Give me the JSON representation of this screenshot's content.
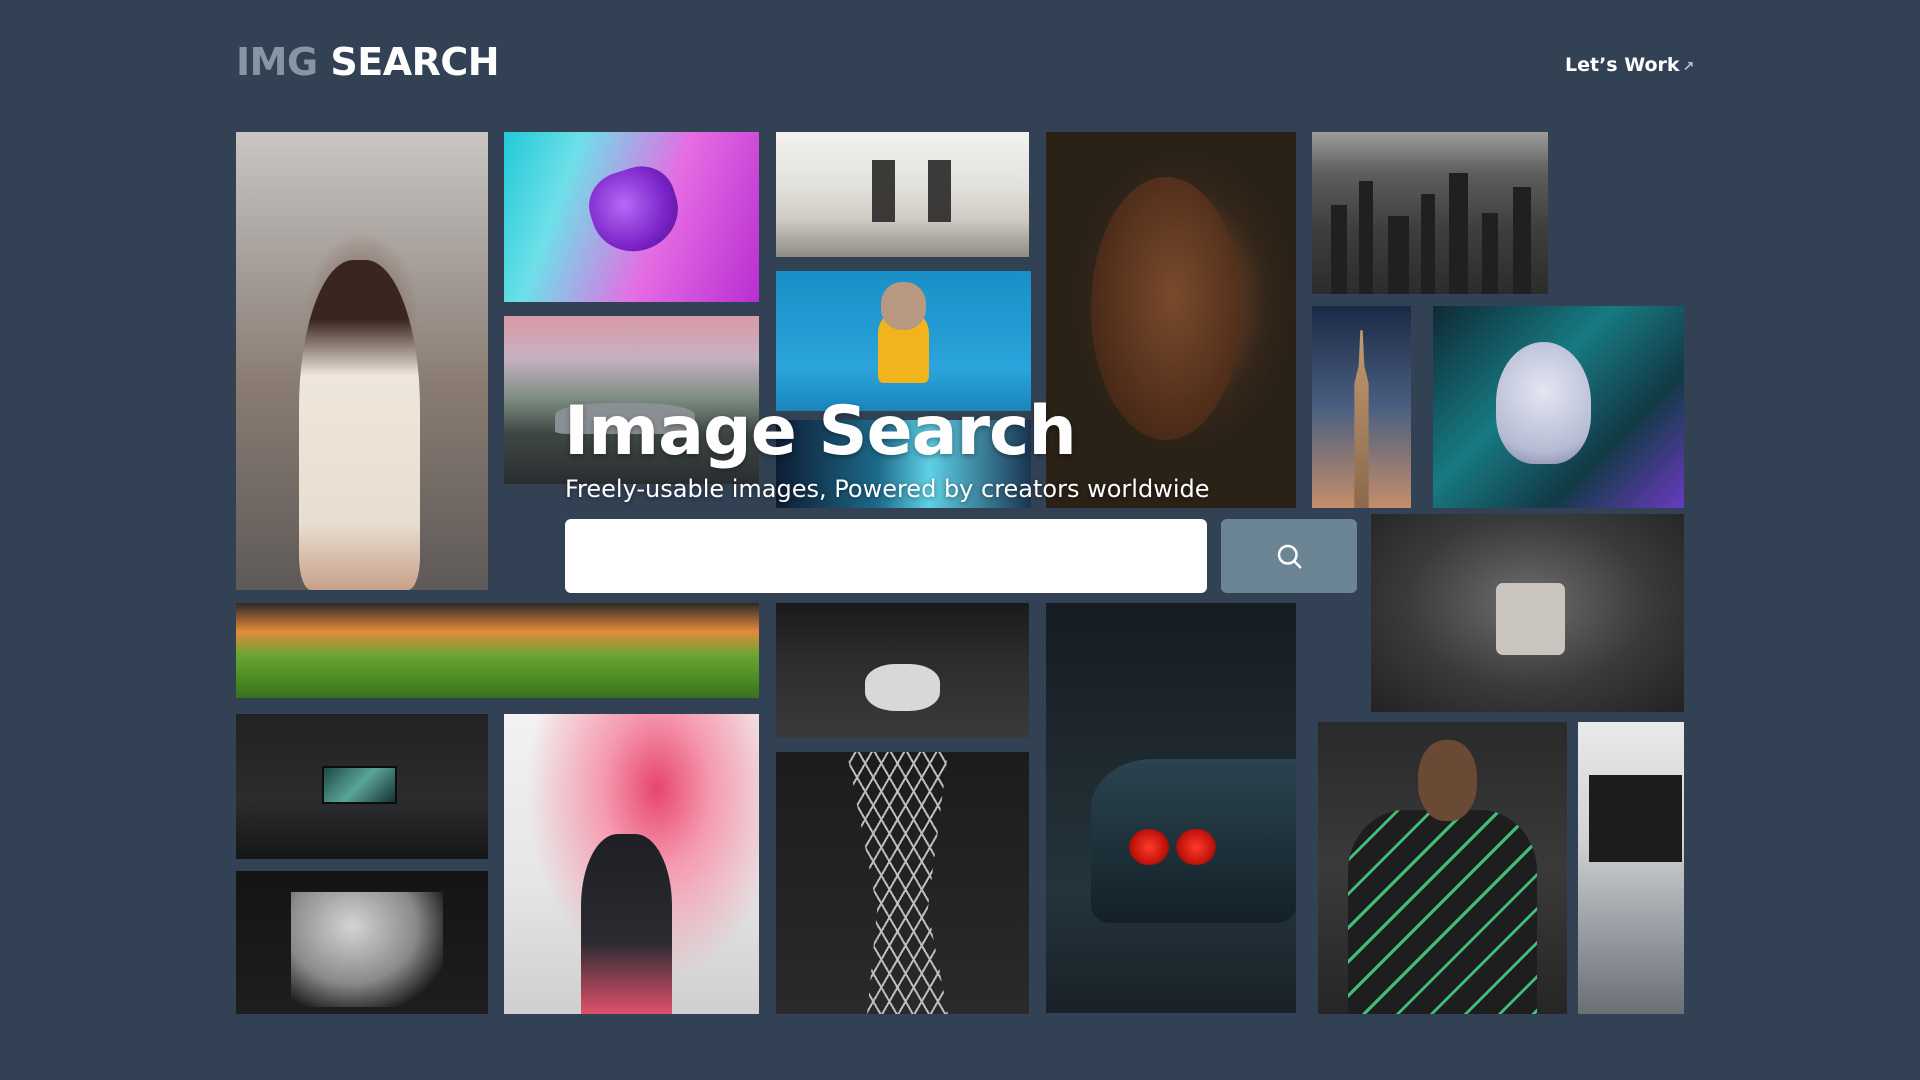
{
  "header": {
    "logo_part1": "IMG",
    "logo_part2": "SEARCH",
    "cta_label": "Let’s Work",
    "cta_icon": "arrow-up-right-icon"
  },
  "hero": {
    "title": "Image Search",
    "subtitle": "Freely-usable images, Powered by creators worldwide"
  },
  "search": {
    "value": "",
    "placeholder": "",
    "button_icon": "search-icon"
  },
  "colors": {
    "background": "#324154",
    "search_button": "#6b8594",
    "logo_muted": "#8796a6"
  },
  "gallery": [
    "woman-portrait",
    "purple-game-controller",
    "living-room",
    "french-bulldog",
    "sports-car-road",
    "light-streaks",
    "woman-eyes-closed",
    "city-skyline",
    "empire-state-building",
    "neon-fox-mask",
    "green-valley-sunset",
    "leather-jacket",
    "red-taillights-car",
    "white-robot-figure",
    "desk-monitor",
    "red-smoke-flare",
    "lattice-tower",
    "marble-statue",
    "man-patterned-jacket",
    "laptop"
  ]
}
